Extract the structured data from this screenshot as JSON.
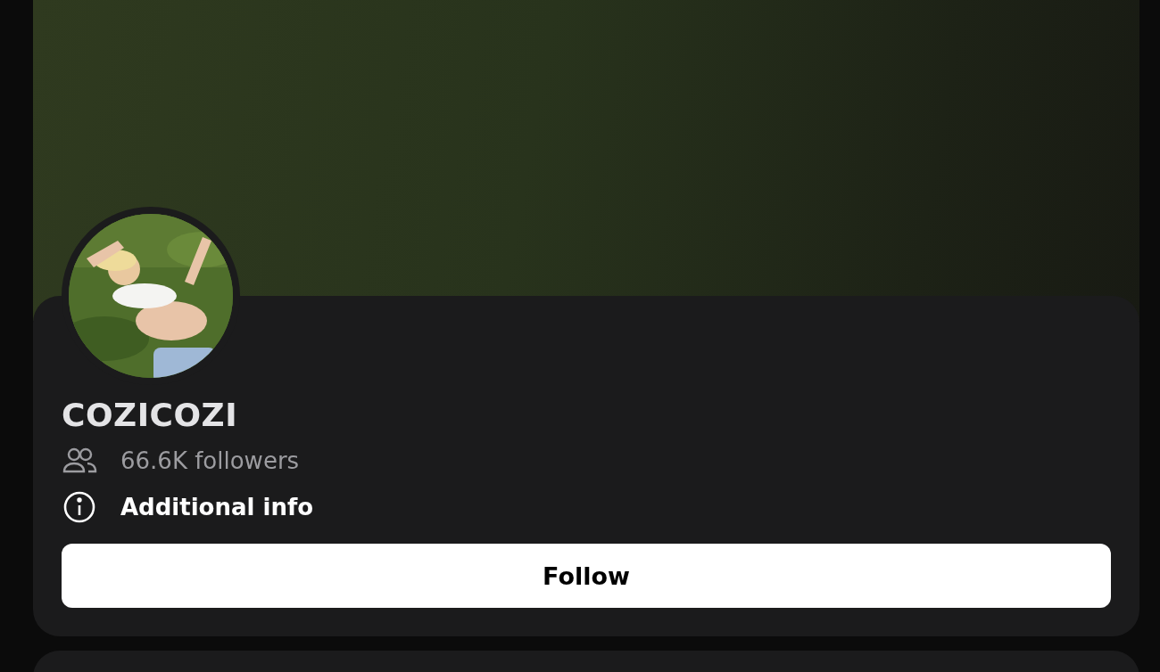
{
  "profile": {
    "name": "COZICOZI",
    "followers": "66.6K followers",
    "info_link": "Additional info",
    "follow_button": "Follow"
  }
}
